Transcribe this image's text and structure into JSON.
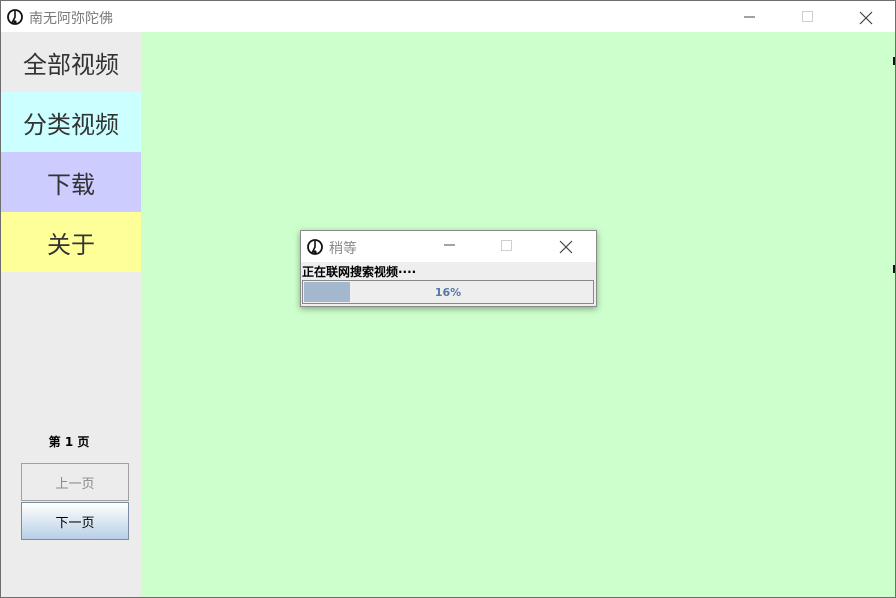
{
  "window": {
    "title": "南无阿弥陀佛"
  },
  "sidebar": {
    "items": [
      {
        "label": "全部视频",
        "color": "#ececec"
      },
      {
        "label": "分类视频",
        "color": "#ccffff"
      },
      {
        "label": "下载",
        "color": "#ccccff"
      },
      {
        "label": "关于",
        "color": "#ffff99"
      }
    ],
    "page_label": "第 1 页",
    "prev_label": "上一页",
    "next_label": "下一页"
  },
  "content": {
    "background": "#ccffcc"
  },
  "dialog": {
    "title": "稍等",
    "message": "正在联网搜索视频····",
    "progress_percent": 16,
    "progress_text": "16%"
  },
  "icons": {
    "app": "app-logo-icon",
    "minimize": "minimize-icon",
    "maximize": "maximize-icon",
    "close": "close-icon"
  }
}
